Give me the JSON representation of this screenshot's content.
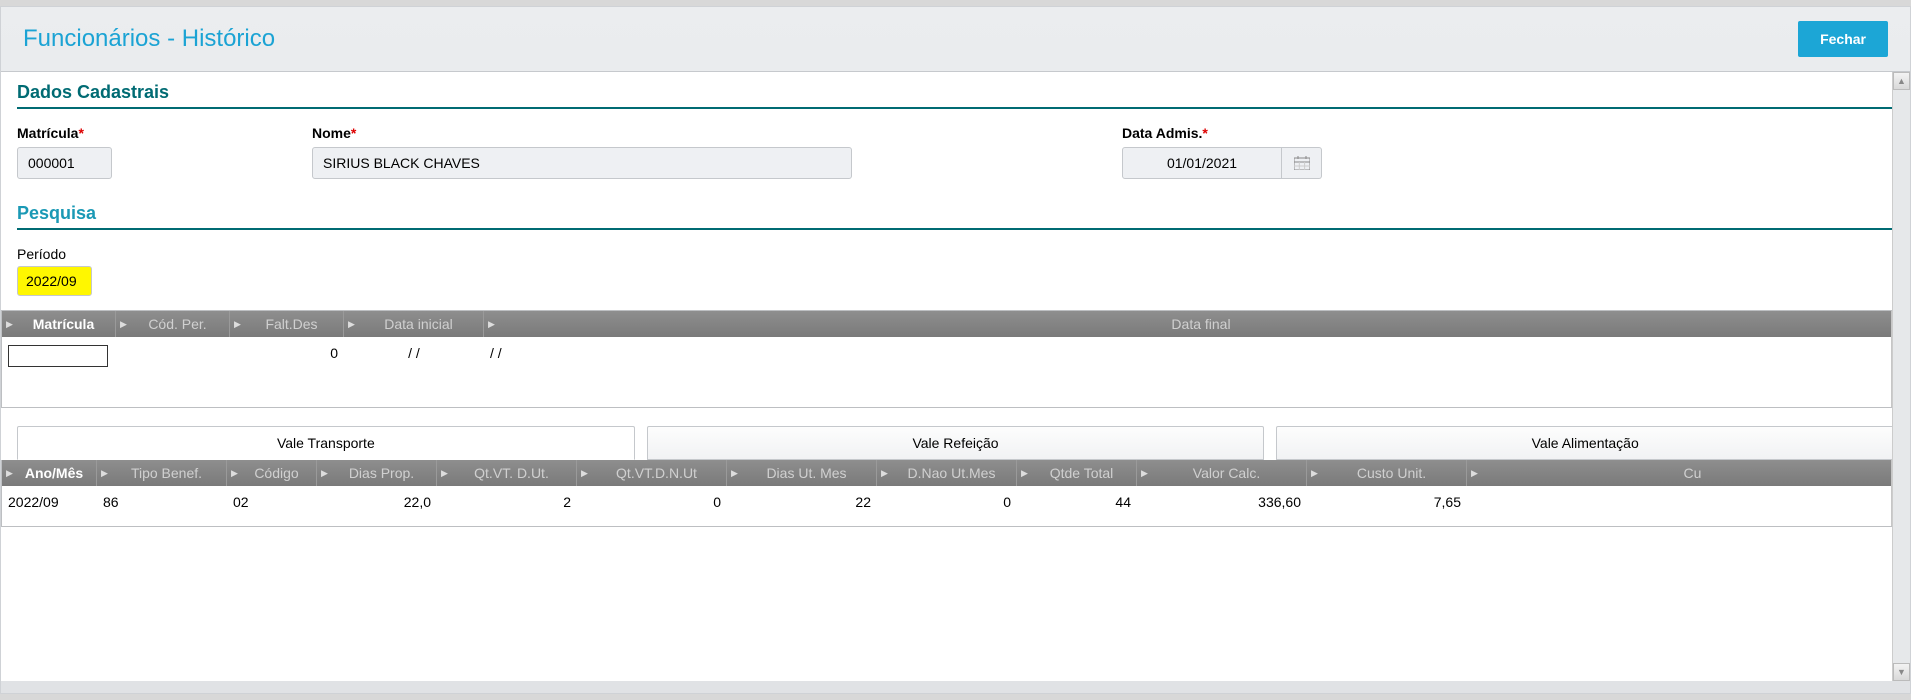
{
  "header": {
    "title": "Funcionários - Histórico",
    "close_label": "Fechar"
  },
  "sections": {
    "dados_title": "Dados Cadastrais",
    "pesquisa_title": "Pesquisa"
  },
  "fields": {
    "matricula_label": "Matrícula",
    "matricula_value": "000001",
    "nome_label": "Nome",
    "nome_value": "SIRIUS BLACK CHAVES",
    "data_admis_label": "Data Admis.",
    "data_admis_value": "01/01/2021",
    "periodo_label": "Período",
    "periodo_value": "2022/09"
  },
  "grid1": {
    "headers": [
      "Matrícula",
      "Cód. Per.",
      "Falt.Des",
      "Data inicial",
      "Data final"
    ],
    "row": {
      "matricula": "",
      "codper": "",
      "faltdes": "0",
      "data_inicial": "/  /",
      "data_final": "/  /"
    }
  },
  "tabs": {
    "t0": "Vale Transporte",
    "t1": "Vale Refeição",
    "t2": "Vale Alimentação"
  },
  "grid2": {
    "headers": [
      "Ano/Mês",
      "Tipo Benef.",
      "Código",
      "Dias Prop.",
      "Qt.VT. D.Ut.",
      "Qt.VT.D.N.Ut",
      "Dias Ut. Mes",
      "D.Nao Ut.Mes",
      "Qtde Total",
      "Valor Calc.",
      "Custo Unit.",
      "Cu"
    ],
    "row": {
      "anomes": "2022/09",
      "tipobenef": "86",
      "codigo": "02",
      "diasprop": "22,0",
      "qtvtdut": "2",
      "qtvtdnut": "0",
      "diasutmes": "22",
      "dnaoutmes": "0",
      "qtdetotal": "44",
      "valorcalc": "336,60",
      "custounit": "7,65"
    }
  }
}
